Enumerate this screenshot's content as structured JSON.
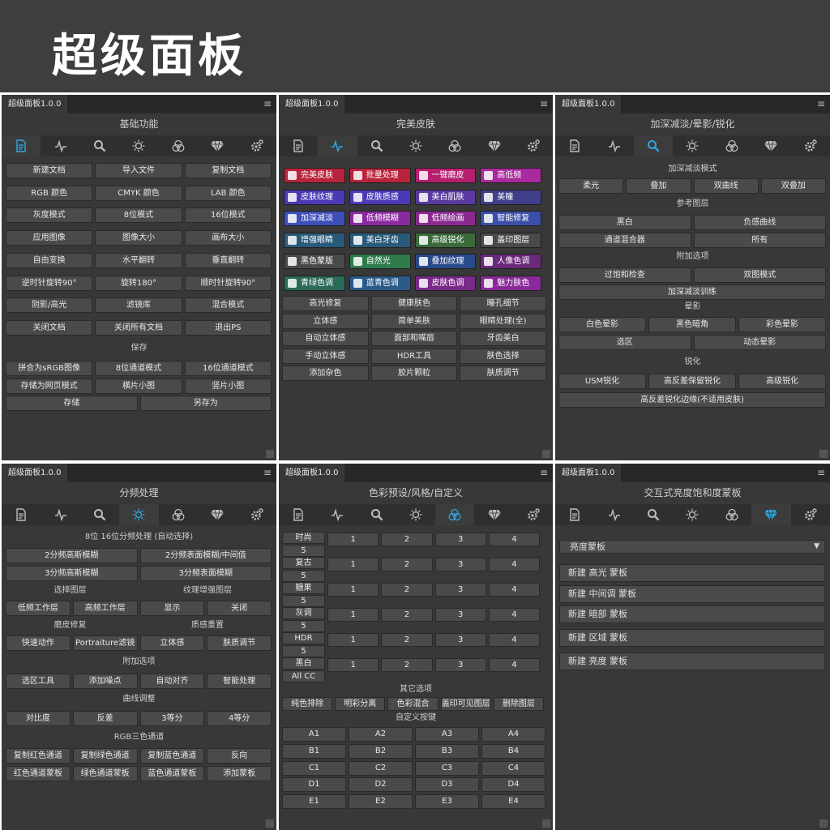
{
  "header": {
    "title": "超级面板"
  },
  "panel_tab": "超级面板1.0.0",
  "icons": [
    "document-icon",
    "pulse-icon",
    "search-icon",
    "sun-icon",
    "circles-icon",
    "diamond-icon",
    "gear-icon"
  ],
  "colors": {
    "active_icon": "#2ea8e6",
    "icon": "#bdbdbd"
  },
  "p1": {
    "title": "基础功能",
    "rows": [
      [
        "新建文档",
        "导入文件",
        "复制文档"
      ],
      [
        "RGB 颜色",
        "CMYK 颜色",
        "LAB 颜色"
      ],
      [
        "灰度模式",
        "8位模式",
        "16位模式"
      ],
      [
        "应用图像",
        "图像大小",
        "画布大小"
      ],
      [
        "自由变换",
        "水平翻转",
        "垂直翻转"
      ],
      [
        "逆时针旋转90°",
        "旋转180°",
        "顺时针旋转90°"
      ],
      [
        "阴影/高光",
        "滤镜库",
        "混合模式"
      ],
      [
        "关闭文档",
        "关闭所有文档",
        "退出PS"
      ]
    ],
    "save_label": "保存",
    "save_rows": [
      [
        "拼合为sRGB图像",
        "8位通道模式",
        "16位通道模式"
      ],
      [
        "存储为网页模式",
        "横片小图",
        "竖片小图"
      ]
    ],
    "final_row": [
      "存储",
      "另存为"
    ]
  },
  "p2": {
    "title": "完美皮肤",
    "color_rows": [
      [
        {
          "t": "完美皮肤",
          "c": "#b8243c"
        },
        {
          "t": "批量处理",
          "c": "#b8243c"
        },
        {
          "t": "一键磨皮",
          "c": "#b51f6e"
        },
        {
          "t": "高低频",
          "c": "#a82a9e"
        }
      ],
      [
        {
          "t": "皮肤纹理",
          "c": "#4a3ab5"
        },
        {
          "t": "皮肤质感",
          "c": "#4a3ab5"
        },
        {
          "t": "美白肌肤",
          "c": "#5a3aa0"
        },
        {
          "t": "美瞳",
          "c": "#3f3f8a"
        }
      ],
      [
        {
          "t": "加深减淡",
          "c": "#3d4fb8"
        },
        {
          "t": "低频模糊",
          "c": "#8a2aa0"
        },
        {
          "t": "低频绘画",
          "c": "#8a2a90"
        },
        {
          "t": "智能修复",
          "c": "#3a4fa8"
        }
      ],
      [
        {
          "t": "增强眼睛",
          "c": "#2a5a7a"
        },
        {
          "t": "美白牙齿",
          "c": "#2a5a7a"
        },
        {
          "t": "高级锐化",
          "c": "#3a6a3a"
        },
        {
          "t": "盖印图层",
          "c": "#4a4a4a"
        }
      ],
      [
        {
          "t": "黑色蒙版",
          "c": "#4a4a4a"
        },
        {
          "t": "自然光",
          "c": "#2f7a4a"
        },
        {
          "t": "叠加纹理",
          "c": "#2a4a8a"
        },
        {
          "t": "人像色调",
          "c": "#6a2a7a"
        }
      ],
      [
        {
          "t": "青绿色调",
          "c": "#2a6a5a"
        },
        {
          "t": "蓝青色调",
          "c": "#2a5a8a"
        },
        {
          "t": "皮肤色调",
          "c": "#7a2a8a"
        },
        {
          "t": "魅力肤色",
          "c": "#8a2a9a"
        }
      ]
    ],
    "rows": [
      [
        "高光修复",
        "健康肤色",
        "瞳孔细节"
      ],
      [
        "立体感",
        "简单美肤",
        "眼睛处理(全)"
      ],
      [
        "自动立体感",
        "面部和嘴唇",
        "牙齿美白"
      ],
      [
        "手动立体感",
        "HDR工具",
        "肤色选择"
      ],
      [
        "添加杂色",
        "胶片颗粒",
        "肤质调节"
      ]
    ]
  },
  "p3": {
    "title": "加深减淡/晕影/锐化",
    "mode_label": "加深减淡模式",
    "mode_row": [
      "柔光",
      "叠加",
      "双曲线",
      "双叠加"
    ],
    "ref_label": "参考图层",
    "ref_rows": [
      [
        "黑白",
        "负感曲线"
      ],
      [
        "通道混合器",
        "所有"
      ]
    ],
    "extra_label": "附加选项",
    "extra_row": [
      "过饱和检查",
      "双图模式"
    ],
    "train_btn": "加深减淡训练",
    "vignette_label": "晕影",
    "vignette_row": [
      "白色晕影",
      "黑色暗角",
      "彩色晕影"
    ],
    "vignette_row2": [
      "选区",
      "动态晕影"
    ],
    "sharpen_label": "锐化",
    "sharpen_row": [
      "USM锐化",
      "高反差保留锐化",
      "高级锐化"
    ],
    "sharpen_wide": "高反差锐化边缘(不适用皮肤)"
  },
  "p4": {
    "title": "分频处理",
    "sub_label": "8位 16位分频处理 (自动选择)",
    "pair_rows": [
      [
        "2分频高斯模糊",
        "2分频表面模糊/中间值"
      ],
      [
        "3分频高斯模糊",
        "3分频表面模糊"
      ]
    ],
    "layer_label_a": "选择图层",
    "layer_label_b": "纹理增强图层",
    "layer_row": [
      "低频工作层",
      "高频工作层",
      "显示",
      "关闭"
    ],
    "retouch_label_a": "磨皮修复",
    "retouch_label_b": "质感重置",
    "retouch_row": [
      "快速动作",
      "Portraiture滤镜",
      "立体感",
      "肤质调节"
    ],
    "extra_label": "附加选项",
    "extra_row": [
      "选区工具",
      "添加噪点",
      "自动对齐",
      "智能处理"
    ],
    "curve_label": "曲线调整",
    "curve_row": [
      "对比度",
      "反差",
      "3等分",
      "4等分"
    ],
    "rgb_label": "RGB三色通道",
    "rgb_rows": [
      [
        "复制红色通道",
        "复制绿色通道",
        "复制蓝色通道",
        "反向"
      ],
      [
        "红色通道蒙板",
        "绿色通道蒙板",
        "蓝色通道蒙板",
        "添加蒙板"
      ]
    ]
  },
  "p5": {
    "title": "色彩预设/风格/自定义",
    "presets": [
      {
        "name": "时尚",
        "sub": "5"
      },
      {
        "name": "复古",
        "sub": "5"
      },
      {
        "name": "糖果",
        "sub": "5"
      },
      {
        "name": "灰调",
        "sub": "5"
      },
      {
        "name": "HDR",
        "sub": "5"
      },
      {
        "name": "黑白",
        "sub": "All CC"
      }
    ],
    "nums": [
      "1",
      "2",
      "3",
      "4"
    ],
    "other_label": "其它选项",
    "other_row": [
      "纯色排除",
      "明彩分离",
      "色彩混合",
      "盖印可见图层",
      "删除图层"
    ],
    "custom_label": "自定义按键",
    "custom_rows": [
      [
        "A1",
        "A2",
        "A3",
        "A4"
      ],
      [
        "B1",
        "B2",
        "B3",
        "B4"
      ],
      [
        "C1",
        "C2",
        "C3",
        "C4"
      ],
      [
        "D1",
        "D2",
        "D3",
        "D4"
      ],
      [
        "E1",
        "E2",
        "E3",
        "E4"
      ]
    ]
  },
  "p6": {
    "title": "交互式亮度饱和度蒙板",
    "dropdown": "亮度蒙板",
    "mask_buttons": [
      "新建 高光 蒙板",
      "新建 中间调 蒙板",
      "新建 暗部 蒙板",
      "新建 区域 蒙板",
      "新建 亮度 蒙板"
    ]
  }
}
